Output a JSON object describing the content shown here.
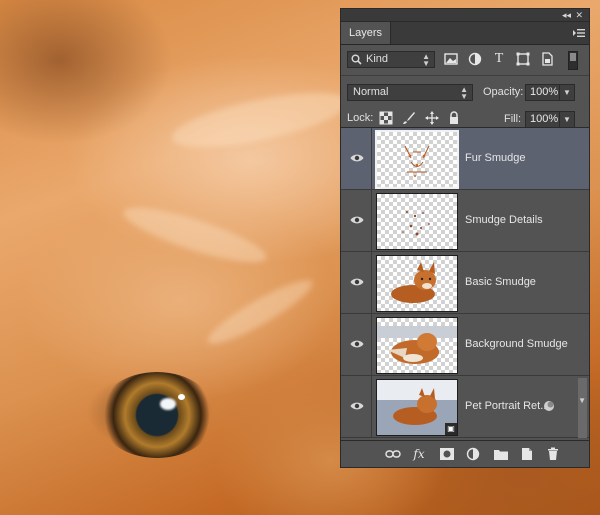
{
  "panel": {
    "tab_title": "Layers",
    "filter": {
      "kind_label": "Kind"
    },
    "blend": {
      "mode": "Normal",
      "opacity_label": "Opacity:",
      "opacity_value": "100%"
    },
    "lock": {
      "label": "Lock:",
      "fill_label": "Fill:",
      "fill_value": "100%"
    },
    "layers": [
      {
        "name": "Fur Smudge",
        "selected": true,
        "visible": true
      },
      {
        "name": "Smudge Details",
        "selected": false,
        "visible": true
      },
      {
        "name": "Basic Smudge",
        "selected": false,
        "visible": true
      },
      {
        "name": "Background Smudge",
        "selected": false,
        "visible": true
      },
      {
        "name": "Pet Portrait Ret...",
        "selected": false,
        "visible": true,
        "smart_object": true
      }
    ]
  },
  "colors": {
    "panel_bg": "#535353",
    "selected_row": "#5d6271",
    "text": "#e6e6e6"
  },
  "icons": {
    "filter": [
      "search-icon",
      "image-filter-icon",
      "adjustment-filter-icon",
      "type-filter-icon",
      "shape-filter-icon",
      "smart-object-filter-icon"
    ],
    "lock": [
      "lock-transparent-pixels-icon",
      "lock-image-pixels-icon",
      "lock-position-icon",
      "lock-all-icon"
    ],
    "bottom": [
      "link-layers-icon",
      "fx-icon",
      "add-mask-icon",
      "new-adjustment-layer-icon",
      "new-group-icon",
      "new-layer-icon",
      "delete-layer-icon"
    ]
  }
}
